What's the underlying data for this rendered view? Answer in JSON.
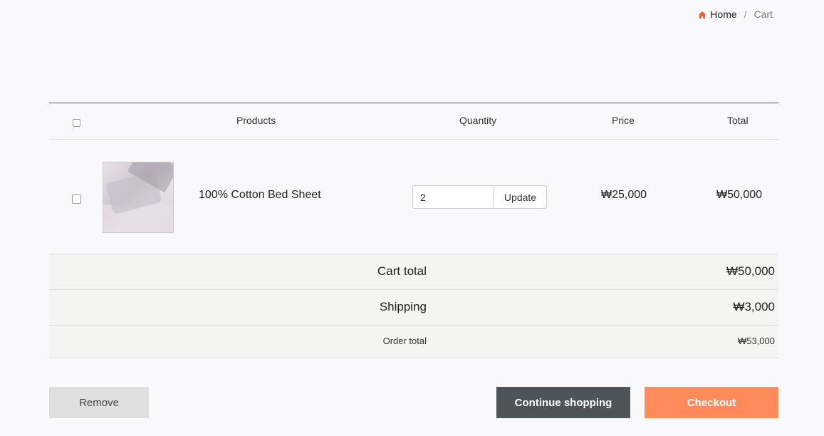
{
  "breadcrumb": {
    "home": "Home",
    "separator": "/",
    "current": "Cart"
  },
  "table": {
    "headers": {
      "products": "Products",
      "quantity": "Quantity",
      "price": "Price",
      "total": "Total"
    }
  },
  "items": [
    {
      "name": "100% Cotton Bed Sheet",
      "quantity": "2",
      "update_label": "Update",
      "price": "₩25,000",
      "total": "₩50,000",
      "checked": false
    }
  ],
  "summary": {
    "cart_total_label": "Cart total",
    "cart_total_value": "₩50,000",
    "shipping_label": "Shipping",
    "shipping_value": "₩3,000",
    "order_total_label": "Order total",
    "order_total_value": "₩53,000"
  },
  "actions": {
    "remove": "Remove",
    "continue": "Continue shopping",
    "checkout": "Checkout"
  },
  "colors": {
    "accent": "#ff8a5c",
    "dark_button": "#4f5459",
    "home_icon": "#e8622a"
  },
  "icons": {
    "home": "home-icon",
    "product_image": "bed-sheet-thumbnail"
  }
}
